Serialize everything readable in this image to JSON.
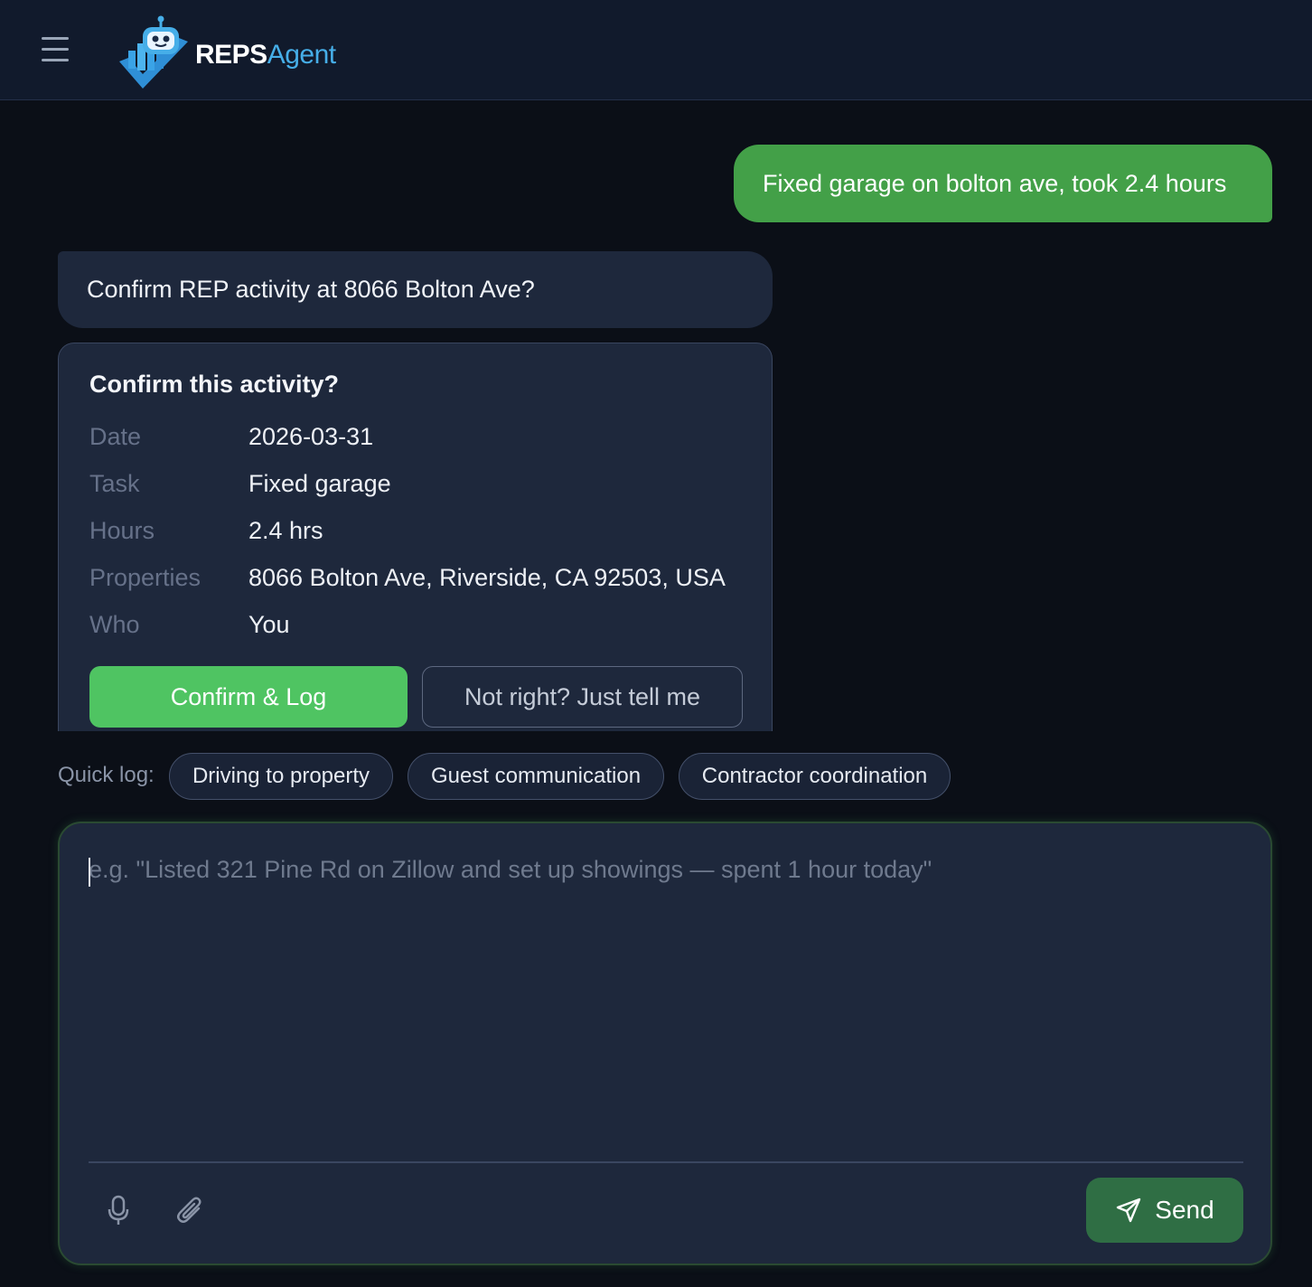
{
  "header": {
    "logo": {
      "text_bold": "REPS",
      "text_light": "Agent"
    }
  },
  "chat": {
    "user_message": "Fixed garage on bolton ave, took 2.4 hours",
    "bot_message": "Confirm REP activity at 8066 Bolton Ave?"
  },
  "card": {
    "title": "Confirm this activity?",
    "rows": [
      {
        "label": "Date",
        "value": "2026-03-31"
      },
      {
        "label": "Task",
        "value": "Fixed garage"
      },
      {
        "label": "Hours",
        "value": "2.4 hrs"
      },
      {
        "label": "Properties",
        "value": "8066 Bolton Ave, Riverside, CA 92503, USA"
      },
      {
        "label": "Who",
        "value": "You"
      }
    ],
    "confirm_label": "Confirm & Log",
    "not_right_label": "Not right? Just tell me"
  },
  "quick_log": {
    "label": "Quick log:",
    "chips": [
      "Driving to property",
      "Guest communication",
      "Contractor coordination"
    ]
  },
  "composer": {
    "placeholder": "e.g. \"Listed 321 Pine Rd on Zillow and set up showings — spent 1 hour today\"",
    "value": "",
    "send_label": "Send"
  },
  "colors": {
    "user_bubble": "#43a048",
    "confirm_button": "#4fc462",
    "send_button": "#2f6e44",
    "logo_accent": "#46aee8"
  },
  "icons": [
    "hamburger-icon",
    "logo-robot-icon",
    "microphone-icon",
    "paperclip-icon",
    "send-icon"
  ]
}
